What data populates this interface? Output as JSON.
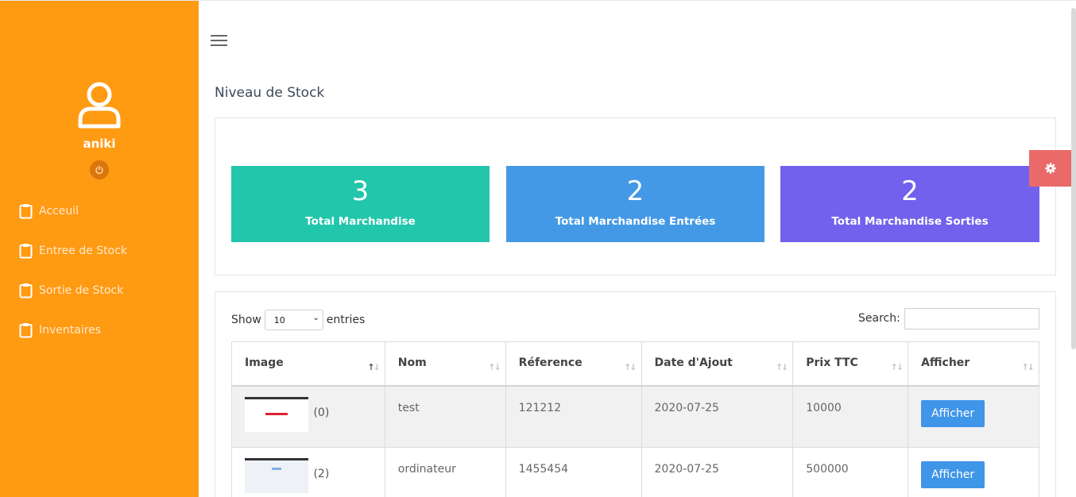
{
  "user": {
    "name": "aniki"
  },
  "sidebar": {
    "items": [
      {
        "label": "Acceuil"
      },
      {
        "label": "Entree de Stock"
      },
      {
        "label": "Sortie de Stock"
      },
      {
        "label": "Inventaires"
      }
    ]
  },
  "page": {
    "title": "Niveau de Stock"
  },
  "stats": [
    {
      "value": "3",
      "label": "Total Marchandise",
      "color": "#22c6ab"
    },
    {
      "value": "2",
      "label": "Total Marchandise Entrées",
      "color": "#4499e6"
    },
    {
      "value": "2",
      "label": "Total Marchandise Sorties",
      "color": "#7261ec"
    }
  ],
  "table_controls": {
    "show_label": "Show",
    "page_size": "10",
    "entries_label": "entries",
    "search_label": "Search:"
  },
  "table": {
    "headers": [
      "Image",
      "Nom",
      "Réference",
      "Date d'Ajout",
      "Prix TTC",
      "Afficher"
    ],
    "rows": [
      {
        "image_count": "(0)",
        "nom": "test",
        "reference": "121212",
        "date": "2020-07-25",
        "prix": "10000",
        "action": "Afficher"
      },
      {
        "image_count": "(2)",
        "nom": "ordinateur",
        "reference": "1455454",
        "date": "2020-07-25",
        "prix": "500000",
        "action": "Afficher"
      }
    ]
  },
  "colors": {
    "sidebar": "#ff9a13",
    "settings_button": "#ea6a6a",
    "action_button": "#3f95e8"
  },
  "icons": [
    "user-icon",
    "power-icon",
    "clipboard-icon",
    "menu-icon",
    "gear-icon",
    "sort-icon"
  ]
}
